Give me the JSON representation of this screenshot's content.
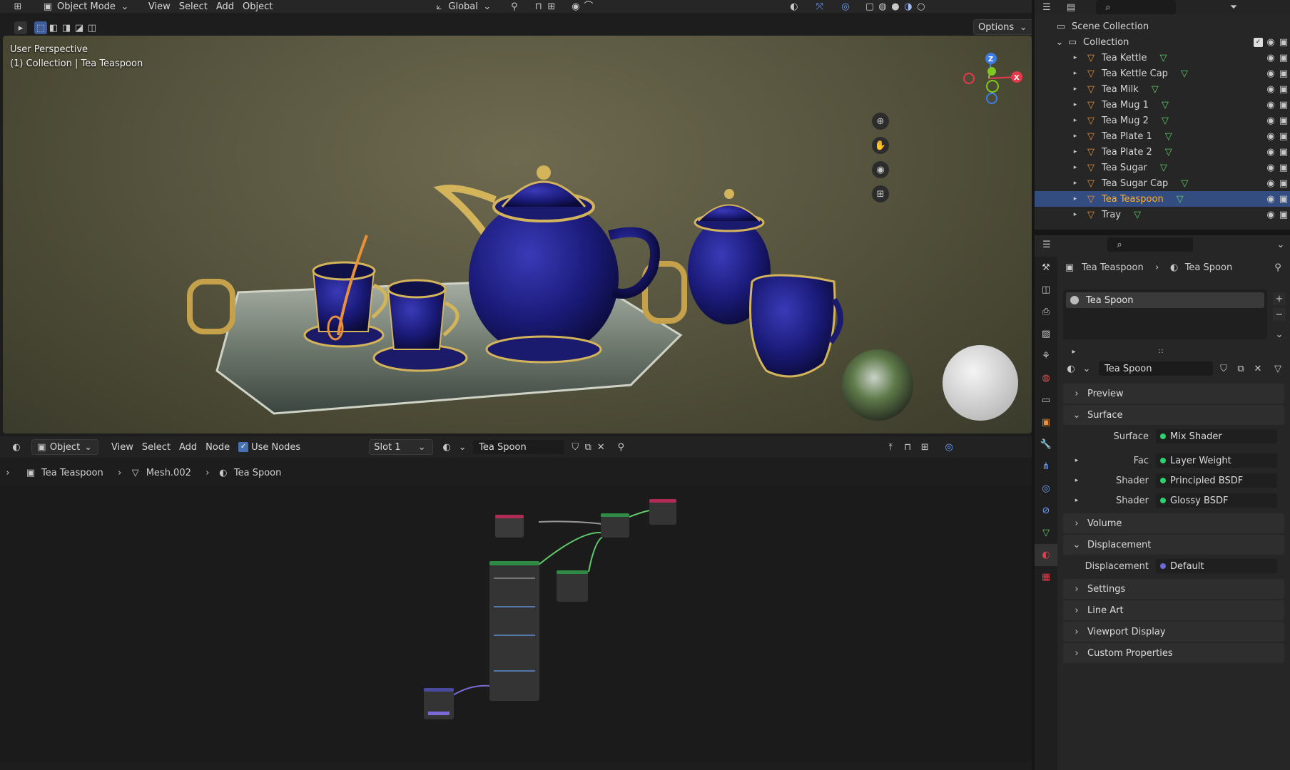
{
  "colors": {
    "accent": "#334d80",
    "selected_text": "#ffaf29",
    "shader_green": "#2ed16b",
    "displace_blue": "#6a6ad8",
    "axis_x": "#e8394a",
    "axis_y": "#7fc81f",
    "axis_z": "#3c7ee6"
  },
  "topbar": {
    "mode": "Object Mode",
    "menu": [
      "View",
      "Select",
      "Add",
      "Object"
    ],
    "orientation": "Global"
  },
  "viewport": {
    "options_label": "Options",
    "perspective": "User Perspective",
    "collection_line": "(1) Collection | Tea Teaspoon",
    "gizmo": {
      "z": "Z",
      "x": "X"
    }
  },
  "node_header": {
    "editor_type": "Object",
    "menu": [
      "View",
      "Select",
      "Add",
      "Node"
    ],
    "use_nodes_label": "Use Nodes",
    "slot": "Slot 1",
    "material": "Tea Spoon"
  },
  "node_breadcrumb": {
    "object": "Tea Teaspoon",
    "mesh": "Mesh.002",
    "material": "Tea Spoon"
  },
  "outliner": {
    "scene_collection": "Scene Collection",
    "collection": "Collection",
    "items": [
      {
        "label": "Tea Kettle",
        "selected": false
      },
      {
        "label": "Tea Kettle Cap",
        "selected": false
      },
      {
        "label": "Tea Milk",
        "selected": false
      },
      {
        "label": "Tea Mug 1",
        "selected": false
      },
      {
        "label": "Tea Mug 2",
        "selected": false
      },
      {
        "label": "Tea Plate 1",
        "selected": false
      },
      {
        "label": "Tea Plate 2",
        "selected": false
      },
      {
        "label": "Tea Sugar",
        "selected": false
      },
      {
        "label": "Tea Sugar Cap",
        "selected": false
      },
      {
        "label": "Tea Teaspoon",
        "selected": true
      },
      {
        "label": "Tray",
        "selected": false
      }
    ]
  },
  "properties": {
    "breadcrumb": {
      "object": "Tea Teaspoon",
      "material": "Tea Spoon"
    },
    "slot_item": "Tea Spoon",
    "material_name": "Tea Spoon",
    "sections": {
      "preview": "Preview",
      "surface": "Surface",
      "volume": "Volume",
      "displacement": "Displacement",
      "settings": "Settings",
      "line_art": "Line Art",
      "viewport_display": "Viewport Display",
      "custom_properties": "Custom Properties"
    },
    "surface_rows": [
      {
        "label": "Surface",
        "value": "Mix Shader"
      },
      {
        "label": "Fac",
        "value": "Layer Weight"
      },
      {
        "label": "Shader",
        "value": "Principled BSDF"
      },
      {
        "label": "Shader",
        "value": "Glossy BSDF"
      }
    ],
    "displacement_row": {
      "label": "Displacement",
      "value": "Default"
    }
  }
}
